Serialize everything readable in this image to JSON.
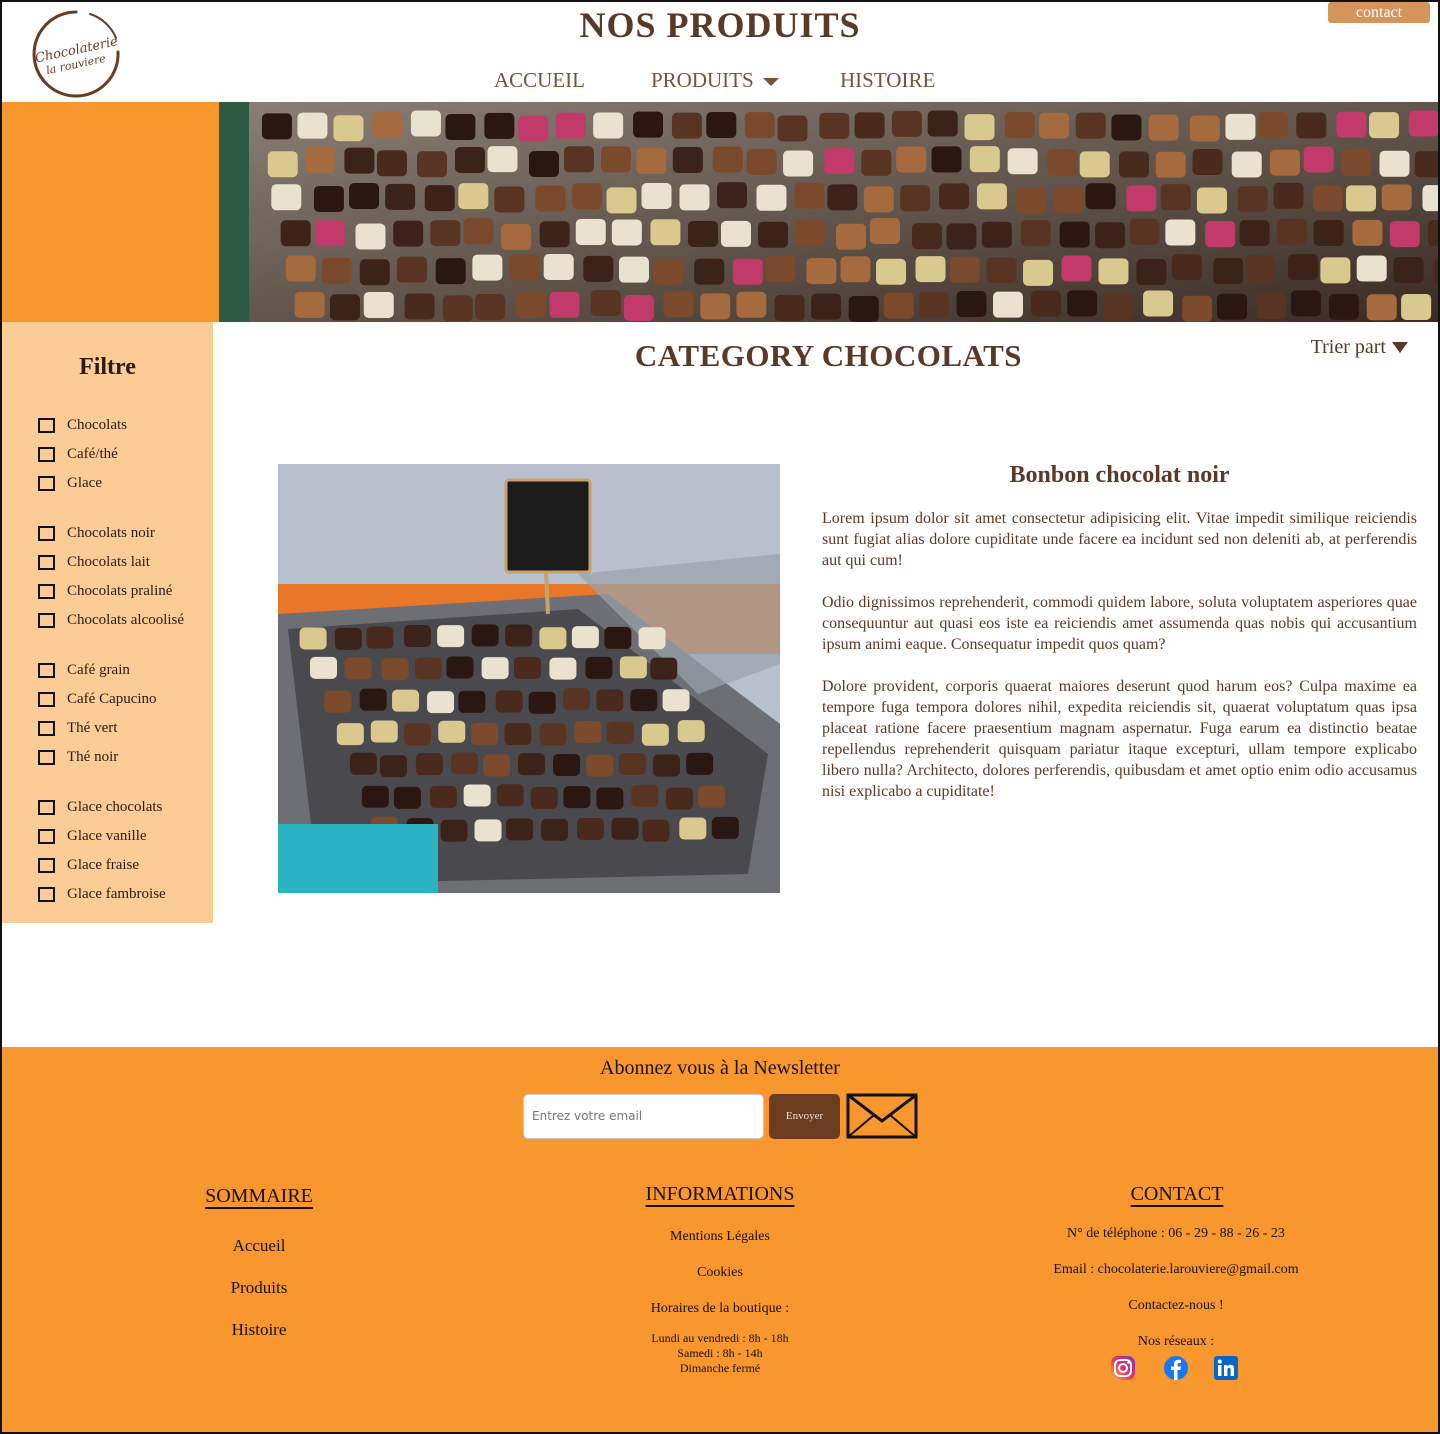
{
  "header": {
    "logo_text_line1": "Chocolaterie",
    "logo_text_line2": "la rouviere",
    "title": "NOS PRODUITS",
    "contact_label": "contact",
    "nav": {
      "accueil": "ACCUEIL",
      "produits": "PRODUITS",
      "histoire": "HISTOIRE"
    }
  },
  "sidebar": {
    "title": "Filtre",
    "groups": [
      [
        "Chocolats",
        "Café/thé",
        "Glace"
      ],
      [
        "Chocolats noir",
        "Chocolats lait",
        "Chocolats praliné",
        "Chocolats alcoolisé"
      ],
      [
        "Café grain",
        "Café Capucino",
        "Thé vert",
        "Thé noir"
      ],
      [
        "Glace chocolats",
        "Glace vanille",
        "Glace fraise",
        "Glace fambroise"
      ]
    ]
  },
  "main": {
    "category_title": "CATEGORY CHOCOLATS",
    "sort_label": "Trier part",
    "product": {
      "name": "Bonbon chocolat noir",
      "paragraphs": [
        "Lorem ipsum dolor sit amet consectetur adipisicing elit. Vitae impedit similique reiciendis sunt fugiat alias dolore cupiditate unde facere ea incidunt sed non deleniti ab, at perferendis aut qui cum!",
        "Odio dignissimos reprehenderit, commodi quidem labore, soluta voluptatem asperiores quae consequuntur aut quasi eos iste ea reiciendis amet assumenda quas nobis qui accusantium ipsum animi eaque. Consequatur impedit quos quam?",
        "Dolore provident, corporis quaerat maiores deserunt quod harum eos? Culpa maxime ea tempore fuga tempora dolores nihil, expedita reiciendis sit, quaerat voluptatum quas ipsa placeat ratione facere praesentium magnam aspernatur. Fuga earum ea distinctio beatae repellendus reprehenderit quisquam pariatur itaque excepturi, ullam tempore explicabo libero nulla? Architecto, dolores perferendis, quibusdam et amet optio enim odio accusamus nisi explicabo a cupiditate!"
      ]
    }
  },
  "footer": {
    "newsletter": {
      "title": "Abonnez vous à la Newsletter",
      "placeholder": "Entrez votre email",
      "send_label": "Envoyer"
    },
    "sommaire": {
      "title": "SOMMAIRE",
      "links": [
        "Accueil",
        "Produits",
        "Histoire"
      ]
    },
    "informations": {
      "title": "INFORMATIONS",
      "mentions": "Mentions Légales",
      "cookies": "Cookies",
      "hours_title": "Horaires de la boutique :",
      "hours": [
        "Lundi au vendredi : 8h - 18h",
        "Samedi : 8h - 14h",
        "Dimanche fermé"
      ]
    },
    "contact": {
      "title": "CONTACT",
      "phone": "N° de téléphone : 06 - 29 - 88 - 26 - 23",
      "email": "Email : chocolaterie.larouviere@gmail.com",
      "contact_us": "Contactez-nous !",
      "networks_label": "Nos réseaux :"
    }
  },
  "colors": {
    "orange": "#f7972e",
    "light_orange": "#fccc96",
    "brown": "#5a3a26",
    "button_brown": "#6b3c1f",
    "contact_tab": "#d4945c"
  }
}
